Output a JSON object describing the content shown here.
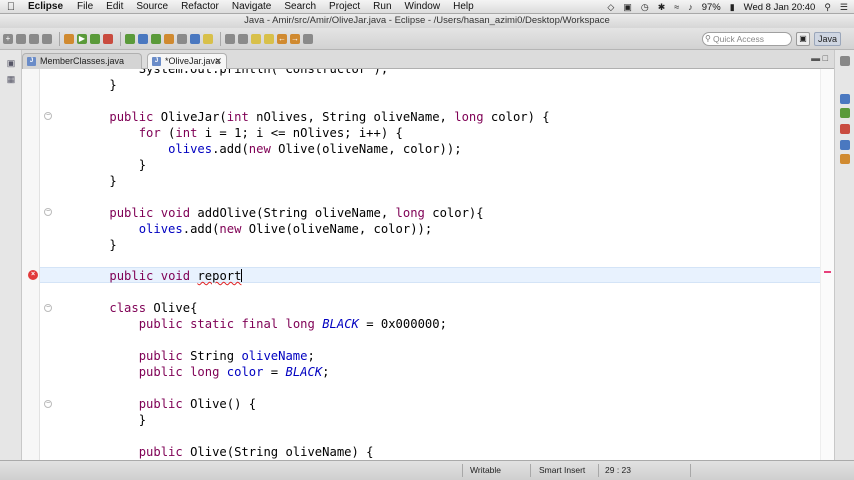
{
  "menubar": {
    "app_name": "Eclipse",
    "items": [
      "File",
      "Edit",
      "Source",
      "Refactor",
      "Navigate",
      "Search",
      "Project",
      "Run",
      "Window",
      "Help"
    ],
    "battery": "97%",
    "clock": "Wed 8 Jan  20:40"
  },
  "window": {
    "title": "Java - Amir/src/Amir/OliveJar.java - Eclipse - /Users/hasan_azimi0/Desktop/Workspace"
  },
  "toolbar": {
    "quick_access_placeholder": "Quick Access",
    "perspective": "Java"
  },
  "tabs": [
    {
      "label": "MemberClasses.java",
      "active": false
    },
    {
      "label": "*OliveJar.java",
      "active": true
    }
  ],
  "status": {
    "mode": "Writable",
    "insert": "Smart Insert",
    "position": "29 : 23"
  },
  "colors": {
    "keyword": "#7f0055",
    "field": "#0000c0",
    "current_line": "#e8f2fe",
    "error": "#e02020"
  }
}
